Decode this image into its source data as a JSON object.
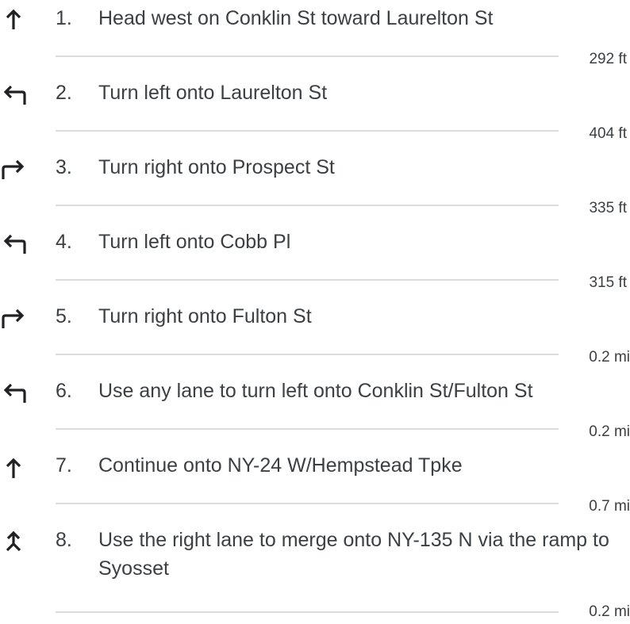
{
  "directions": {
    "steps": [
      {
        "number": "1.",
        "instruction": "Head west on Conklin St toward Laurelton St",
        "distance": "292 ft",
        "maneuver": "straight-icon"
      },
      {
        "number": "2.",
        "instruction": "Turn left onto Laurelton St",
        "distance": "404 ft",
        "maneuver": "turn-left-icon"
      },
      {
        "number": "3.",
        "instruction": "Turn right onto Prospect St",
        "distance": "335 ft",
        "maneuver": "turn-right-icon"
      },
      {
        "number": "4.",
        "instruction": "Turn left onto Cobb Pl",
        "distance": "315 ft",
        "maneuver": "turn-left-icon"
      },
      {
        "number": "5.",
        "instruction": "Turn right onto Fulton St",
        "distance": "0.2 mi",
        "maneuver": "turn-right-icon"
      },
      {
        "number": "6.",
        "instruction": "Use any lane to turn left onto Conklin St/Fulton St",
        "distance": "0.2 mi",
        "maneuver": "turn-left-icon"
      },
      {
        "number": "7.",
        "instruction": "Continue onto NY-24 W/Hempstead Tpke",
        "distance": "0.7 mi",
        "maneuver": "straight-icon"
      },
      {
        "number": "8.",
        "instruction": "Use the right lane to merge onto NY-135 N via the ramp to Syosset",
        "distance": "0.2 mi",
        "maneuver": "merge-icon"
      }
    ]
  },
  "colors": {
    "text": "#3c4043",
    "divider": "#dadce0",
    "icon": "#202124"
  }
}
